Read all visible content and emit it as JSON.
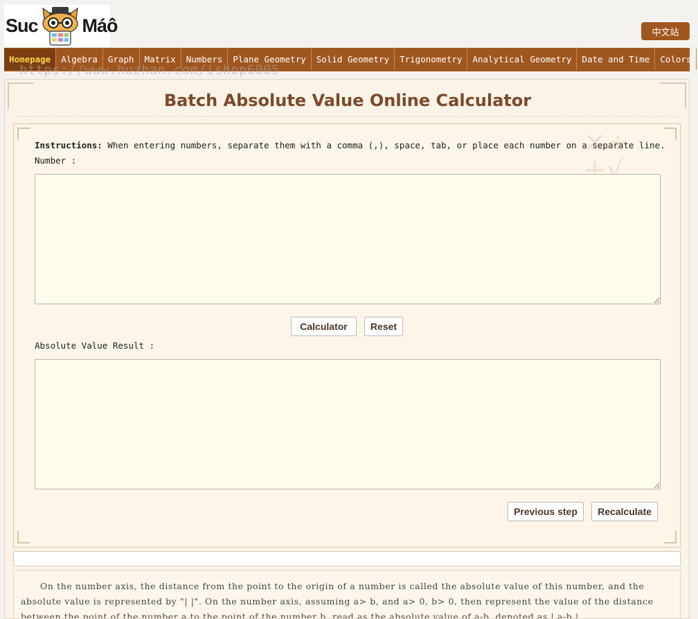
{
  "header": {
    "logo_left": "Suc",
    "logo_right": "Máô",
    "language_button": "中文站"
  },
  "nav": {
    "items": [
      {
        "label": "Homepage",
        "active": true
      },
      {
        "label": "Algebra"
      },
      {
        "label": "Graph"
      },
      {
        "label": "Matrix"
      },
      {
        "label": "Numbers"
      },
      {
        "label": "Plane Geometry"
      },
      {
        "label": "Solid Geometry"
      },
      {
        "label": "Trigonometry"
      },
      {
        "label": "Analytical Geometry"
      },
      {
        "label": "Date and Time"
      },
      {
        "label": "Colors"
      }
    ]
  },
  "watermark": "https://www.huzhan.com/ishop6005",
  "page": {
    "title": "Batch Absolute Value Online Calculator"
  },
  "calculator": {
    "instructions_label": "Instructions:",
    "instructions_text": " When entering numbers, separate them with a comma (,), space, tab, or place each number on a separate line.",
    "input_label": "Number :",
    "input_value": "",
    "calculate_button": "Calculator",
    "reset_button": "Reset",
    "result_label": "Absolute Value Result :",
    "result_value": "",
    "previous_button": "Previous step",
    "recalculate_button": "Recalculate"
  },
  "description": {
    "text": "On the number axis, the distance from the point to the origin of a number is called the absolute value of this number, and the absolute value is represented by \"| |\". On the number axis, assuming a> b, and a> 0, b> 0, then represent the value of the distance between the point of the number a to the point of the number b, read as the absolute value of a-b, denoted as | a-b |."
  },
  "colors": {
    "nav_background": "#a0561f",
    "nav_active_background": "#7a3e12",
    "nav_active_text": "#ffd24a",
    "title": "#7b4a29",
    "textarea_background": "#fffeec"
  }
}
